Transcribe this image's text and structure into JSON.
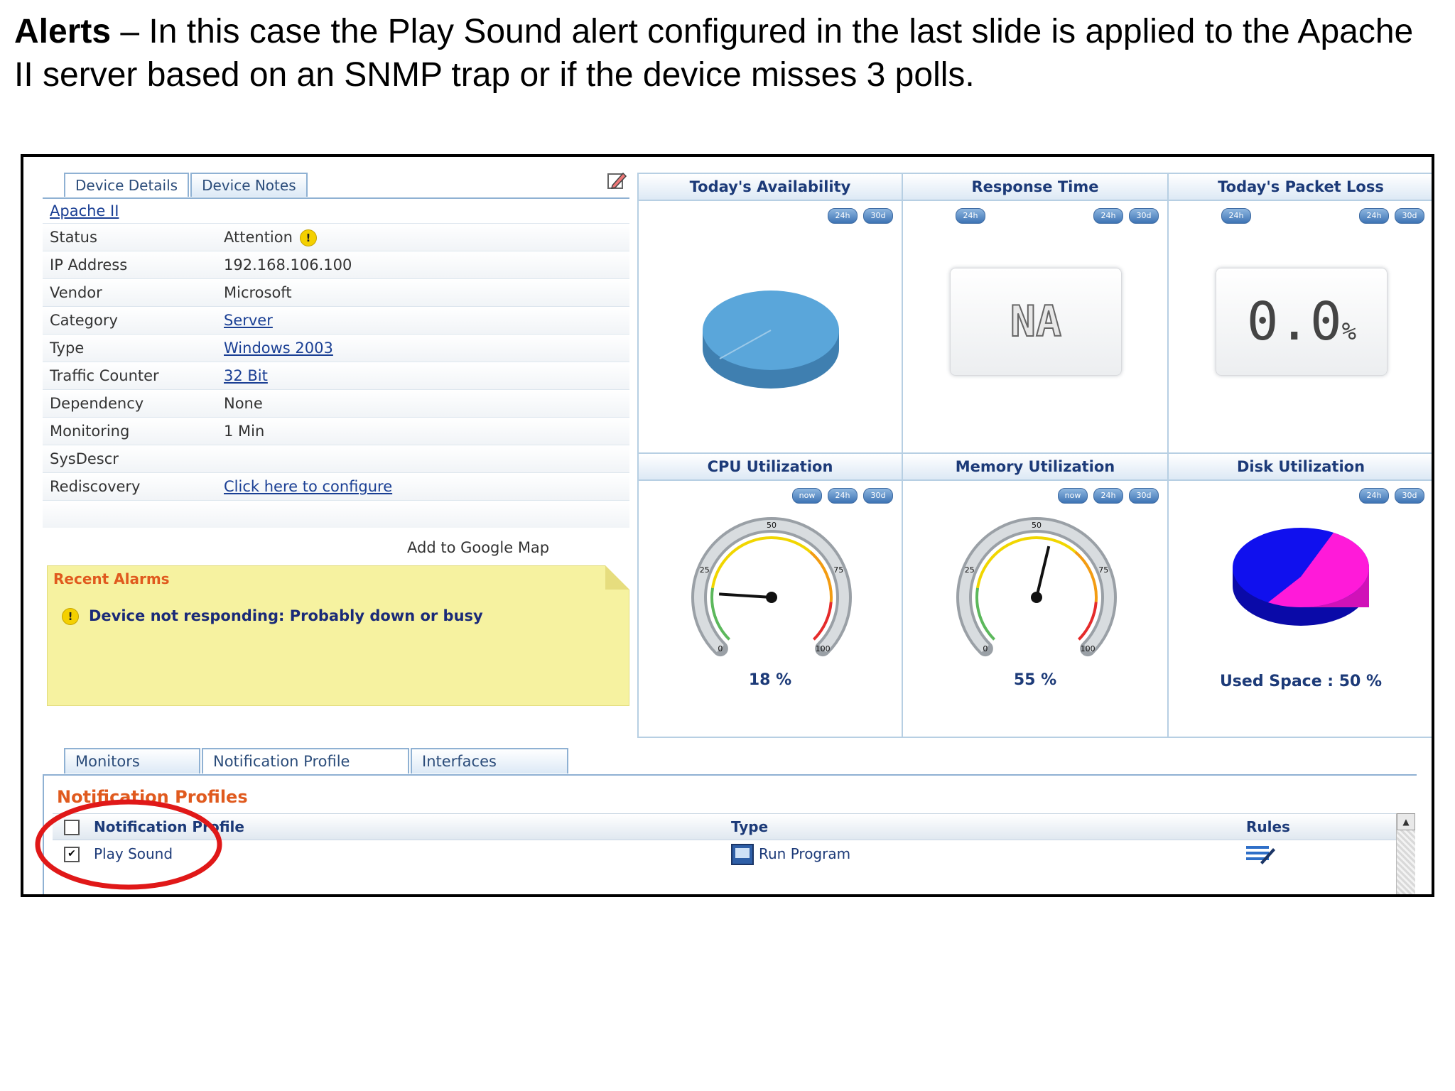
{
  "caption": {
    "bold": "Alerts",
    "text": " – In this case the Play Sound alert configured in the last slide is applied to the Apache II server based on  an SNMP trap or if the device misses 3 polls."
  },
  "tabs_top": [
    "Device Details",
    "Device Notes"
  ],
  "device": {
    "name": "Apache II",
    "rows": [
      {
        "key": "Status",
        "value": "Attention",
        "link": false,
        "warn": true
      },
      {
        "key": "IP Address",
        "value": "192.168.106.100",
        "link": false
      },
      {
        "key": "Vendor",
        "value": "Microsoft",
        "link": false
      },
      {
        "key": "Category",
        "value": "Server",
        "link": true
      },
      {
        "key": "Type",
        "value": "Windows 2003",
        "link": true
      },
      {
        "key": "Traffic Counter",
        "value": "32 Bit",
        "link": true
      },
      {
        "key": "Dependency",
        "value": "None",
        "link": false
      },
      {
        "key": "Monitoring",
        "value": "1 Min",
        "link": false
      },
      {
        "key": "SysDescr",
        "value": "",
        "link": false
      },
      {
        "key": "Rediscovery",
        "value": "Click here to configure",
        "link": true
      }
    ],
    "google_map": "Add to Google Map"
  },
  "alarms": {
    "title": "Recent Alarms",
    "items": [
      "Device not responding: Probably down or busy"
    ]
  },
  "panels": {
    "availability": {
      "title": "Today's Availability",
      "buttons": [
        "24h",
        "30d"
      ]
    },
    "response": {
      "title": "Response Time",
      "value": "NA",
      "buttons": [
        "24h",
        "24h",
        "30d"
      ]
    },
    "packet_loss": {
      "title": "Today's Packet Loss",
      "value": "0.0",
      "unit": "%",
      "buttons": [
        "24h",
        "24h",
        "30d"
      ]
    },
    "cpu": {
      "title": "CPU Utilization",
      "value": 18,
      "label": "18 %",
      "buttons": [
        "now",
        "24h",
        "30d"
      ]
    },
    "memory": {
      "title": "Memory Utilization",
      "value": 55,
      "label": "55 %",
      "buttons": [
        "now",
        "24h",
        "30d"
      ]
    },
    "disk": {
      "title": "Disk Utilization",
      "used_percent": 50,
      "label": "Used Space : 50 %",
      "buttons": [
        "24h",
        "30d"
      ]
    }
  },
  "gauge_ticks": [
    "0",
    "25",
    "50",
    "75",
    "100"
  ],
  "colors": {
    "accent": "#e05a1e",
    "link": "#1a3f94",
    "border": "#8fb1d3",
    "disk_used": "#ff1ad9",
    "disk_free": "#1010ee",
    "pie": "#5aa6da"
  },
  "tabs_bottom": [
    "Monitors",
    "Notification Profile",
    "Interfaces"
  ],
  "notification": {
    "title": "Notification Profiles",
    "columns": [
      "Notification Profile",
      "Type",
      "Rules"
    ],
    "rows": [
      {
        "profile": "Play Sound",
        "type": "Run Program",
        "checked": true
      }
    ]
  }
}
